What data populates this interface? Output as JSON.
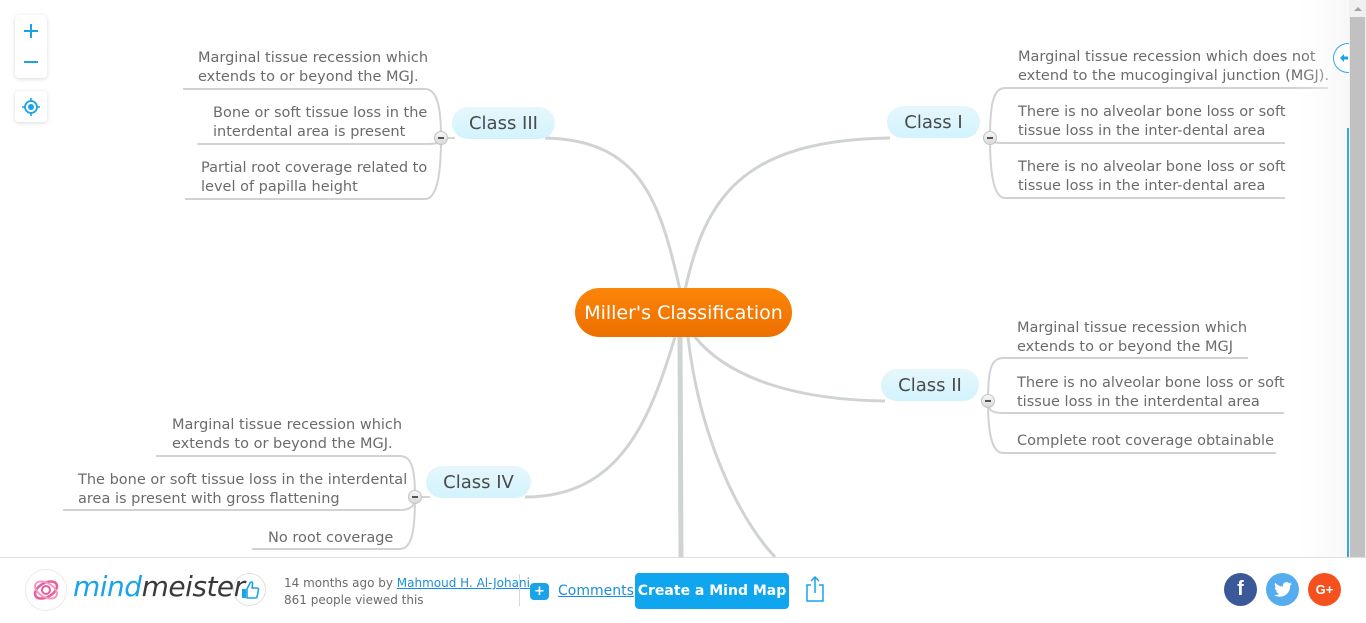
{
  "map": {
    "root": "Miller's Classification",
    "branches": [
      {
        "label": "Class I",
        "side": "right",
        "leaves": [
          "Marginal tissue recession which does not\nextend to the mucogingival junction (MGJ).",
          "There is no alveolar bone loss or soft\ntissue loss in the inter-dental area",
          "There is no alveolar bone loss or soft\ntissue loss in the inter-dental area"
        ]
      },
      {
        "label": "Class II",
        "side": "right",
        "leaves": [
          "Marginal tissue recession which\nextends to or beyond the MGJ",
          "There is no alveolar bone loss or soft\ntissue loss in the interdental area",
          "Complete root coverage obtainable"
        ]
      },
      {
        "label": "Class III",
        "side": "left",
        "leaves": [
          "Marginal tissue recession which\nextends to or beyond the MGJ.",
          "Bone or soft tissue loss in the\ninterdental area is present",
          "Partial root coverage related to\nlevel of papilla height"
        ]
      },
      {
        "label": "Class IV",
        "side": "left",
        "leaves": [
          "Marginal tissue recession which\nextends to or beyond the MGJ.",
          "The bone or soft tissue loss in the interdental\narea is present with gross flattening",
          "No root coverage"
        ]
      }
    ]
  },
  "controls": {
    "zoom_in_icon": "+",
    "zoom_out_icon": "−"
  },
  "footer": {
    "logo_mind": "mind",
    "logo_meister": "meister",
    "time_ago": "14 months ago by ",
    "author": "Mahmoud H. Al-Johani",
    "views": "861 people viewed this",
    "comments_plus": "+",
    "comments_label": "Comments",
    "create_label": "Create a Mind Map",
    "facebook": "f",
    "googleplus": "G+"
  },
  "colors": {
    "accent": "#1aa3e8",
    "root": "#f47b00",
    "branch_bg": "#d9f4fd",
    "connector": "#d0d3d4"
  }
}
